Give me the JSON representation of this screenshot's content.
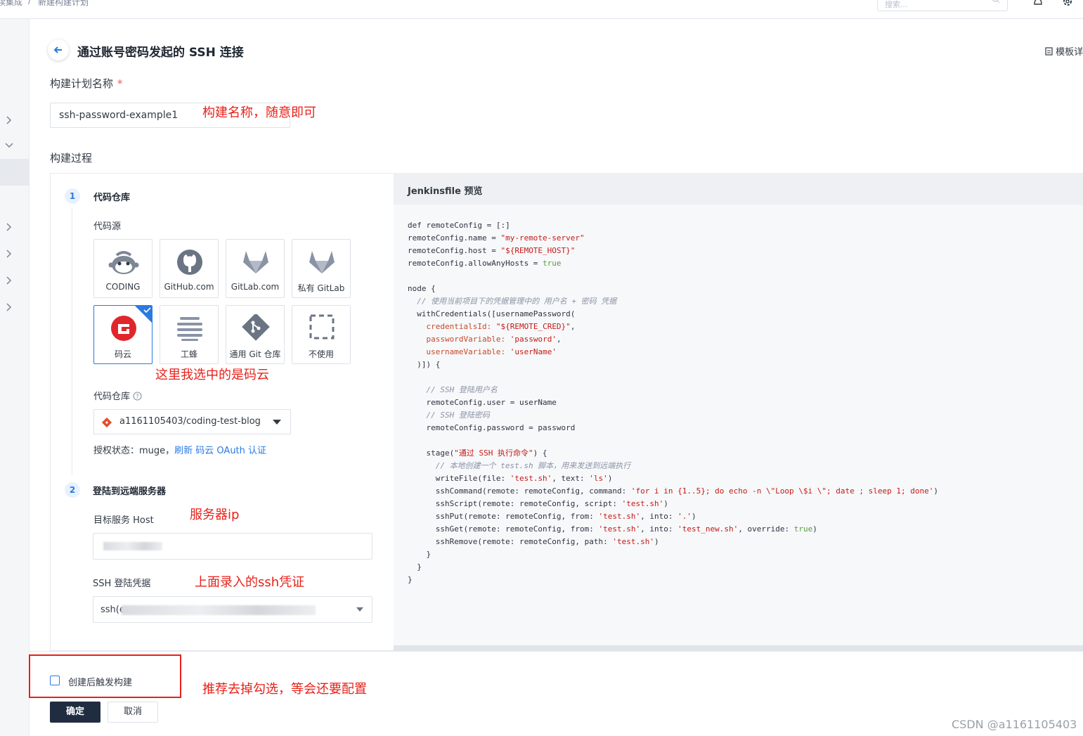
{
  "breadcrumb": {
    "parent": "续集成",
    "current": "新建构建计划",
    "separator": "/"
  },
  "search": {
    "placeholder": "搜索..."
  },
  "header": {
    "title": "通过账号密码发起的 SSH 连接",
    "template_link": "模板详"
  },
  "plan_name": {
    "label": "构建计划名称",
    "required_mark": "*",
    "value": "ssh-password-example1",
    "annotation": "构建名称，随意即可"
  },
  "build_process": {
    "label": "构建过程"
  },
  "step1": {
    "number": "1",
    "title": "代码仓库",
    "source_label": "代码源",
    "sources": [
      {
        "label": "CODING",
        "icon": "coding-monkey-icon",
        "selected": false
      },
      {
        "label": "GitHub.com",
        "icon": "github-icon",
        "selected": false
      },
      {
        "label": "GitLab.com",
        "icon": "gitlab-icon",
        "selected": false
      },
      {
        "label": "私有 GitLab",
        "icon": "gitlab-icon",
        "selected": false
      },
      {
        "label": "码云",
        "icon": "gitee-icon",
        "selected": true
      },
      {
        "label": "工蜂",
        "icon": "gongfeng-icon",
        "selected": false
      },
      {
        "label": "通用 Git 仓库",
        "icon": "git-icon",
        "selected": false
      },
      {
        "label": "不使用",
        "icon": "none-dashed-icon",
        "selected": false
      }
    ],
    "annotation": "这里我选中的是码云",
    "repo_label": "代码仓库",
    "repo_value": "a1161105403/coding-test-blog",
    "auth_label": "授权状态：muge，",
    "auth_link": "刷新 码云 OAuth 认证"
  },
  "step2": {
    "number": "2",
    "title": "登陆到远端服务器",
    "host_label": "目标服务 Host",
    "host_annotation": "服务器ip",
    "host_value": "",
    "cred_label": "SSH 登陆凭据",
    "cred_annotation": "上面录入的ssh凭证",
    "cred_value_prefix": "ssh(e"
  },
  "jenkinsfile": {
    "title": "Jenkinsfile 预览"
  },
  "footer": {
    "trigger_label": "创建后触发构建",
    "trigger_checked": false,
    "trigger_annotation": "推荐去掉勾选，等会还要配置",
    "confirm_label": "确定",
    "cancel_label": "取消"
  },
  "watermark": "CSDN @a1161105403",
  "colors": {
    "accent": "#2a7ae2",
    "annotation_red": "#e8211a",
    "primary_button": "#202d40"
  }
}
